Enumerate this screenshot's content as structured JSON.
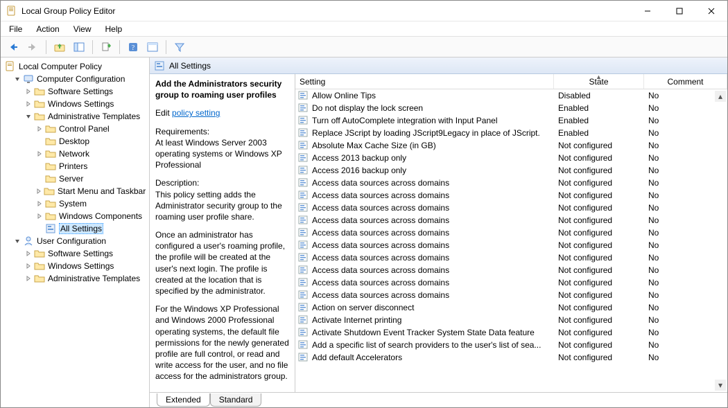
{
  "window": {
    "title": "Local Group Policy Editor"
  },
  "menu": [
    "File",
    "Action",
    "View",
    "Help"
  ],
  "tree": {
    "root": "Local Computer Policy",
    "computer_config": "Computer Configuration",
    "cc_children": {
      "software": "Software Settings",
      "windows": "Windows Settings",
      "admin": "Administrative Templates",
      "admin_children": {
        "control": "Control Panel",
        "desktop": "Desktop",
        "network": "Network",
        "printers": "Printers",
        "server": "Server",
        "start": "Start Menu and Taskbar",
        "system": "System",
        "wincomp": "Windows Components",
        "allsettings": "All Settings"
      }
    },
    "user_config": "User Configuration",
    "uc_children": {
      "software": "Software Settings",
      "windows": "Windows Settings",
      "admin": "Administrative Templates"
    }
  },
  "pane_header": "All Settings",
  "description": {
    "title": "Add the Administrators security group to roaming user profiles",
    "edit_prefix": "Edit ",
    "edit_link": "policy setting ",
    "req_label": "Requirements:",
    "req_text": "At least Windows Server 2003 operating systems or Windows XP Professional",
    "desc_label": "Description:",
    "desc_p1": "This policy setting adds the Administrator security group to the roaming user profile share.",
    "desc_p2": "Once an administrator has configured a user's roaming profile, the profile will be created at the user's next login. The profile is created at the location that is specified by the administrator.",
    "desc_p3": "For the Windows XP Professional and Windows 2000 Professional operating systems, the default file permissions for the newly generated profile are full control, or read and write access for the user, and no file access for the administrators group."
  },
  "columns": {
    "setting": "Setting",
    "state": "State",
    "comment": "Comment"
  },
  "rows": [
    {
      "s": "Allow Online Tips",
      "st": "Disabled",
      "c": "No"
    },
    {
      "s": "Do not display the lock screen",
      "st": "Enabled",
      "c": "No"
    },
    {
      "s": "Turn off AutoComplete integration with Input Panel",
      "st": "Enabled",
      "c": "No"
    },
    {
      "s": "Replace JScript by loading JScript9Legacy in place of JScript.",
      "st": "Enabled",
      "c": "No"
    },
    {
      "s": "Absolute Max Cache Size (in GB)",
      "st": "Not configured",
      "c": "No"
    },
    {
      "s": "Access 2013 backup only",
      "st": "Not configured",
      "c": "No"
    },
    {
      "s": "Access 2016 backup only",
      "st": "Not configured",
      "c": "No"
    },
    {
      "s": "Access data sources across domains",
      "st": "Not configured",
      "c": "No"
    },
    {
      "s": "Access data sources across domains",
      "st": "Not configured",
      "c": "No"
    },
    {
      "s": "Access data sources across domains",
      "st": "Not configured",
      "c": "No"
    },
    {
      "s": "Access data sources across domains",
      "st": "Not configured",
      "c": "No"
    },
    {
      "s": "Access data sources across domains",
      "st": "Not configured",
      "c": "No"
    },
    {
      "s": "Access data sources across domains",
      "st": "Not configured",
      "c": "No"
    },
    {
      "s": "Access data sources across domains",
      "st": "Not configured",
      "c": "No"
    },
    {
      "s": "Access data sources across domains",
      "st": "Not configured",
      "c": "No"
    },
    {
      "s": "Access data sources across domains",
      "st": "Not configured",
      "c": "No"
    },
    {
      "s": "Access data sources across domains",
      "st": "Not configured",
      "c": "No"
    },
    {
      "s": "Action on server disconnect",
      "st": "Not configured",
      "c": "No"
    },
    {
      "s": "Activate Internet printing",
      "st": "Not configured",
      "c": "No"
    },
    {
      "s": "Activate Shutdown Event Tracker System State Data feature",
      "st": "Not configured",
      "c": "No"
    },
    {
      "s": "Add a specific list of search providers to the user's list of sea...",
      "st": "Not configured",
      "c": "No"
    },
    {
      "s": "Add default Accelerators",
      "st": "Not configured",
      "c": "No"
    }
  ],
  "tabs": {
    "extended": "Extended",
    "standard": "Standard"
  }
}
